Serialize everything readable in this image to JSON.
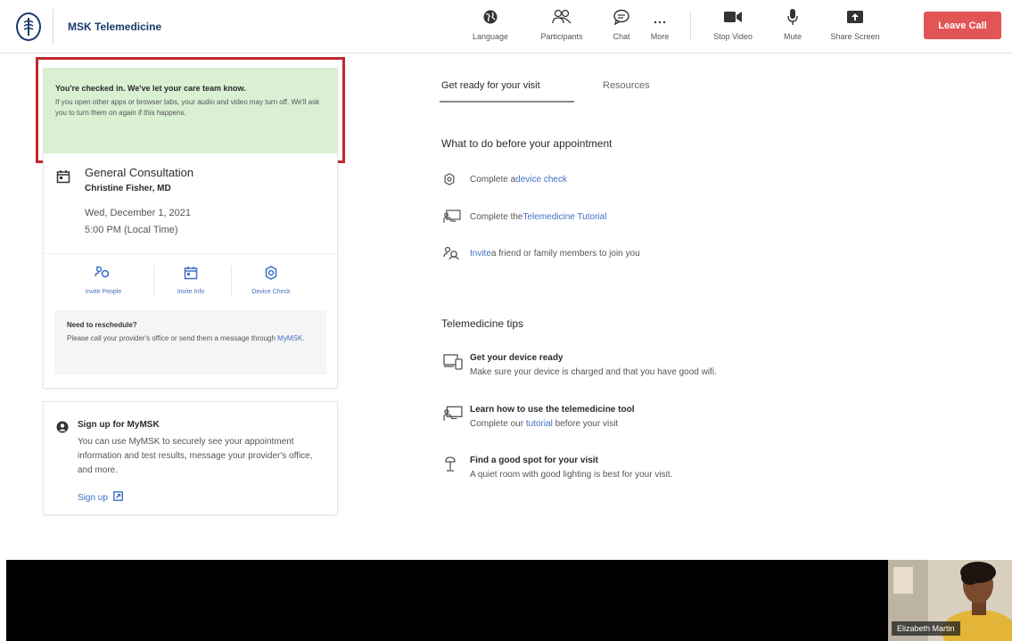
{
  "header": {
    "brand": "MSK Telemedicine",
    "toolbar": [
      {
        "id": "language",
        "label": "Language",
        "icon": "globe-icon"
      },
      {
        "id": "participants",
        "label": "Participants",
        "icon": "people-icon"
      },
      {
        "id": "chat",
        "label": "Chat",
        "icon": "chat-bubble-icon"
      },
      {
        "id": "more",
        "label": "More",
        "icon": "ellipsis-icon"
      },
      {
        "id": "stop-video",
        "label": "Stop Video",
        "icon": "video-camera-icon"
      },
      {
        "id": "mute",
        "label": "Mute",
        "icon": "microphone-icon"
      },
      {
        "id": "share-screen",
        "label": "Share Screen",
        "icon": "share-screen-icon"
      }
    ],
    "leave_label": "Leave Call",
    "leave_color": "#e25555",
    "brand_color": "#1a3a6b"
  },
  "alert": {
    "title": "You're checked in. We've let your care team know.",
    "body": "If you open other apps or browser tabs, your audio and video may turn off. We'll ask you to turn them on again if this happens.",
    "background": "#d9f0d3",
    "outline_color": "#c0282e"
  },
  "appointment": {
    "title": "General Consultation",
    "doctor": "Christine Fisher, MD",
    "date": "Wed, December 1, 2021",
    "time": "5:00 PM (Local Time)",
    "actions": [
      {
        "label": "Invite People",
        "icon": "invite-people-icon"
      },
      {
        "label": "Invite Info",
        "icon": "calendar-icon"
      },
      {
        "label": "Device Check",
        "icon": "gear-icon"
      }
    ],
    "reschedule": {
      "title": "Need to reschedule?",
      "body": "Please call your provider's office or send them a message through ",
      "link": "MyMSK",
      "after": "."
    }
  },
  "signup": {
    "title": "Sign up for MyMSK",
    "body": "You can use MyMSK to securely see your appointment information and test results, message your provider's office, and more.",
    "link": "Sign up",
    "icon": "user-circle-icon"
  },
  "tabs": [
    {
      "label": "Get ready for your visit",
      "active": true
    },
    {
      "label": "Resources",
      "active": false
    }
  ],
  "todo": {
    "heading": "What to do before your appointment",
    "items": [
      {
        "before": "Complete a ",
        "link": "device check",
        "after": "",
        "icon": "gear-icon"
      },
      {
        "before": "Complete the ",
        "link": "Telemedicine Tutorial",
        "after": "",
        "icon": "tutorial-icon"
      },
      {
        "before": "",
        "link": "Invite",
        "after": " a friend or family members to join you",
        "icon": "invite-people-icon"
      }
    ]
  },
  "tips": {
    "heading": "Telemedicine tips",
    "items": [
      {
        "title": "Get your device ready",
        "body_before": "Make sure your device is charged and that you have good wifi.",
        "link": "",
        "body_after": "",
        "icon": "devices-icon"
      },
      {
        "title": "Learn how to use the telemedicine tool",
        "body_before": "Complete our ",
        "link": "tutorial",
        "body_after": " before your visit",
        "icon": "tutorial-icon"
      },
      {
        "title": "Find a good spot for your visit",
        "body_before": "A quiet room with good lighting is best for your visit.",
        "link": "",
        "body_after": "",
        "icon": "lamp-icon"
      }
    ]
  },
  "video": {
    "self_name": "Elizabeth Martin"
  },
  "colors": {
    "link": "#3f6fc4"
  }
}
